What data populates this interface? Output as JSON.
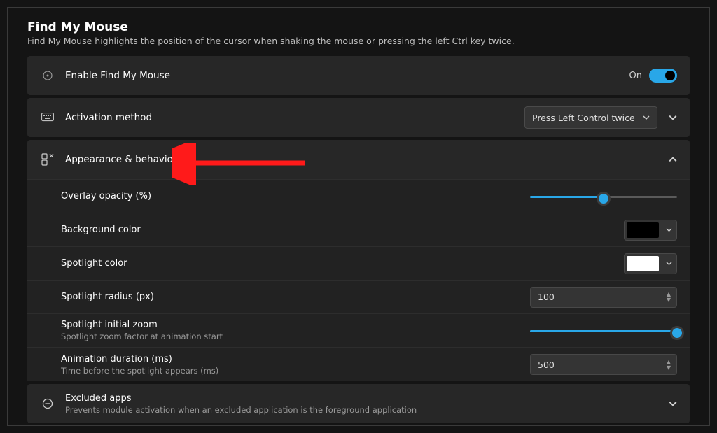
{
  "header": {
    "title": "Find My Mouse",
    "subtitle": "Find My Mouse highlights the position of the cursor when shaking the mouse or pressing the left Ctrl key twice."
  },
  "enable": {
    "label": "Enable Find My Mouse",
    "state_text": "On",
    "on": true
  },
  "activation": {
    "label": "Activation method",
    "selected": "Press Left Control twice"
  },
  "appearance": {
    "header": "Appearance & behavior",
    "overlay_opacity": {
      "label": "Overlay opacity (%)",
      "percent": 50
    },
    "background_color": {
      "label": "Background color",
      "value": "#000000"
    },
    "spotlight_color": {
      "label": "Spotlight color",
      "value": "#ffffff"
    },
    "spotlight_radius": {
      "label": "Spotlight radius (px)",
      "value": "100"
    },
    "spotlight_zoom": {
      "label": "Spotlight initial zoom",
      "desc": "Spotlight zoom factor at animation start",
      "percent": 100
    },
    "animation_duration": {
      "label": "Animation duration (ms)",
      "desc": "Time before the spotlight appears (ms)",
      "value": "500"
    }
  },
  "excluded": {
    "label": "Excluded apps",
    "desc": "Prevents module activation when an excluded application is the foreground application"
  }
}
